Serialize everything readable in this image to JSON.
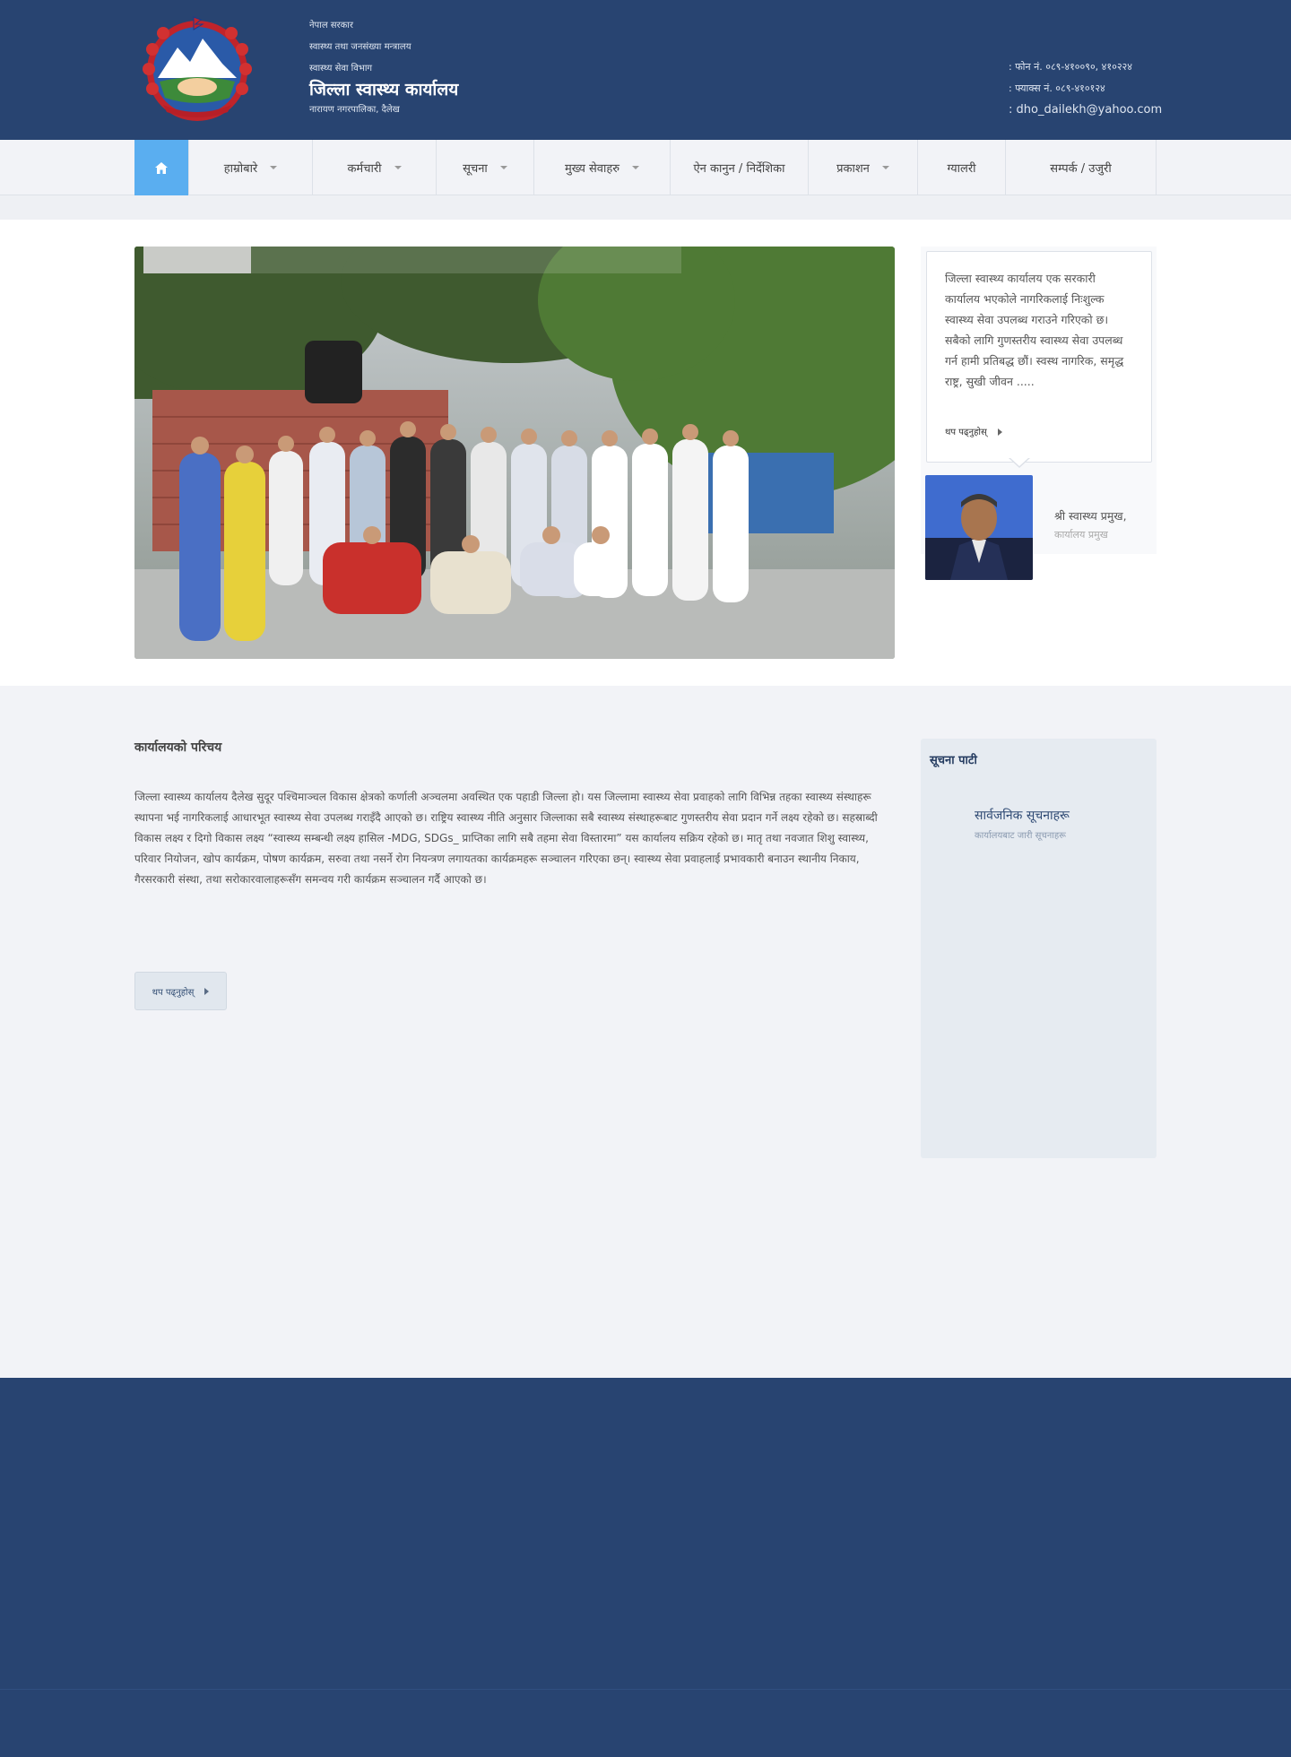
{
  "header": {
    "line1": "नेपाल सरकार",
    "line2": "स्वास्थ्य तथा जनसंख्या मन्त्रालय",
    "line3": "स्वास्थ्य सेवा विभाग",
    "office_name": "जिल्ला स्वास्थ्य कार्यालय",
    "office_address": "नारायण नगरपालिका, दैलेख",
    "phone": ": फोन नं. ०८९-४१००९०, ४१०२२४",
    "fax": ": फ्याक्स नं. ०८९-४१०१२४",
    "email": ": dho_dailekh@yahoo.com"
  },
  "nav": {
    "items": [
      {
        "label": "हाम्रोबारे",
        "dropdown": true
      },
      {
        "label": "कर्मचारी",
        "dropdown": true
      },
      {
        "label": "सूचना",
        "dropdown": true
      },
      {
        "label": "मुख्य सेवाहरु",
        "dropdown": true
      },
      {
        "label": "ऐन कानुन / निर्देशिका",
        "dropdown": false
      },
      {
        "label": "प्रकाशन",
        "dropdown": true
      },
      {
        "label": "ग्यालरी",
        "dropdown": false
      },
      {
        "label": "सम्पर्क / उजुरी",
        "dropdown": false
      }
    ]
  },
  "hero": {
    "quote": "जिल्ला स्वास्थ्य कार्यालय एक सरकारी कार्यालय भएकोले नागरिकलाई निःशुल्क स्वास्थ्य सेवा उपलब्ध गराउने गरिएको छ। सबैको लागि गुणस्तरीय स्वास्थ्य सेवा उपलब्ध गर्न हामी प्रतिबद्ध छौं। स्वस्थ नागरिक, समृद्ध राष्ट्र, सुखी जीवन .....",
    "more_label": "थप पढ्नुहोस्",
    "person_name": "श्री स्वास्थ्य प्रमुख,",
    "person_title": "कार्यालय प्रमुख"
  },
  "intro": {
    "title": "कार्यालयको परिचय",
    "text": "जिल्ला स्वास्थ्य कार्यालय दैलेख सुदूर पश्चिमाञ्चल विकास क्षेत्रको कर्णाली अञ्चलमा अवस्थित एक पहाडी जिल्ला हो। यस जिल्लामा स्वास्थ्य सेवा प्रवाहको लागि विभिन्न तहका स्वास्थ्य संस्थाहरू स्थापना भई नागरिकलाई आधारभूत स्वास्थ्य सेवा उपलब्ध गराइँदै आएको छ। राष्ट्रिय स्वास्थ्य नीति अनुसार जिल्लाका सबै स्वास्थ्य संस्थाहरूबाट गुणस्तरीय सेवा प्रदान गर्ने लक्ष्य रहेको छ। सहस्राब्दी विकास लक्ष्य र दिगो विकास लक्ष्य “स्वास्थ्य सम्बन्धी लक्ष्य हासिल -MDG, SDGs_ प्राप्तिका लागि  सबै तहमा सेवा विस्तारमा” यस कार्यालय सक्रिय रहेको छ।  मातृ तथा नवजात शिशु स्वास्थ्य, परिवार नियोजन, खोप कार्यक्रम, पोषण कार्यक्रम, सरुवा तथा नसर्ने रोग नियन्त्रण लगायतका कार्यक्रमहरू सञ्चालन गरिएका छन्। स्वास्थ्य सेवा प्रवाहलाई प्रभावकारी बनाउन स्थानीय निकाय, गैरसरकारी संस्था, तथा सरोकारवालाहरूसँग समन्वय गरी कार्यक्रम सञ्चालन गर्दै आएको छ।",
    "more_label": "थप पढ्नुहोस्"
  },
  "sidebar": {
    "title": "सूचना पाटी",
    "link": "सार्वजनिक सूचनाहरू",
    "sub": "कार्यालयबाट जारी सूचनाहरू"
  },
  "colors": {
    "header_bg": "#284471",
    "nav_home_bg": "#5aaef0",
    "page_bg": "#f2f3f7",
    "sidebar_bg": "#e6ebf1"
  },
  "icons": {
    "home": "home-icon",
    "caret": "caret-down-icon",
    "arrow": "arrow-right-icon"
  }
}
